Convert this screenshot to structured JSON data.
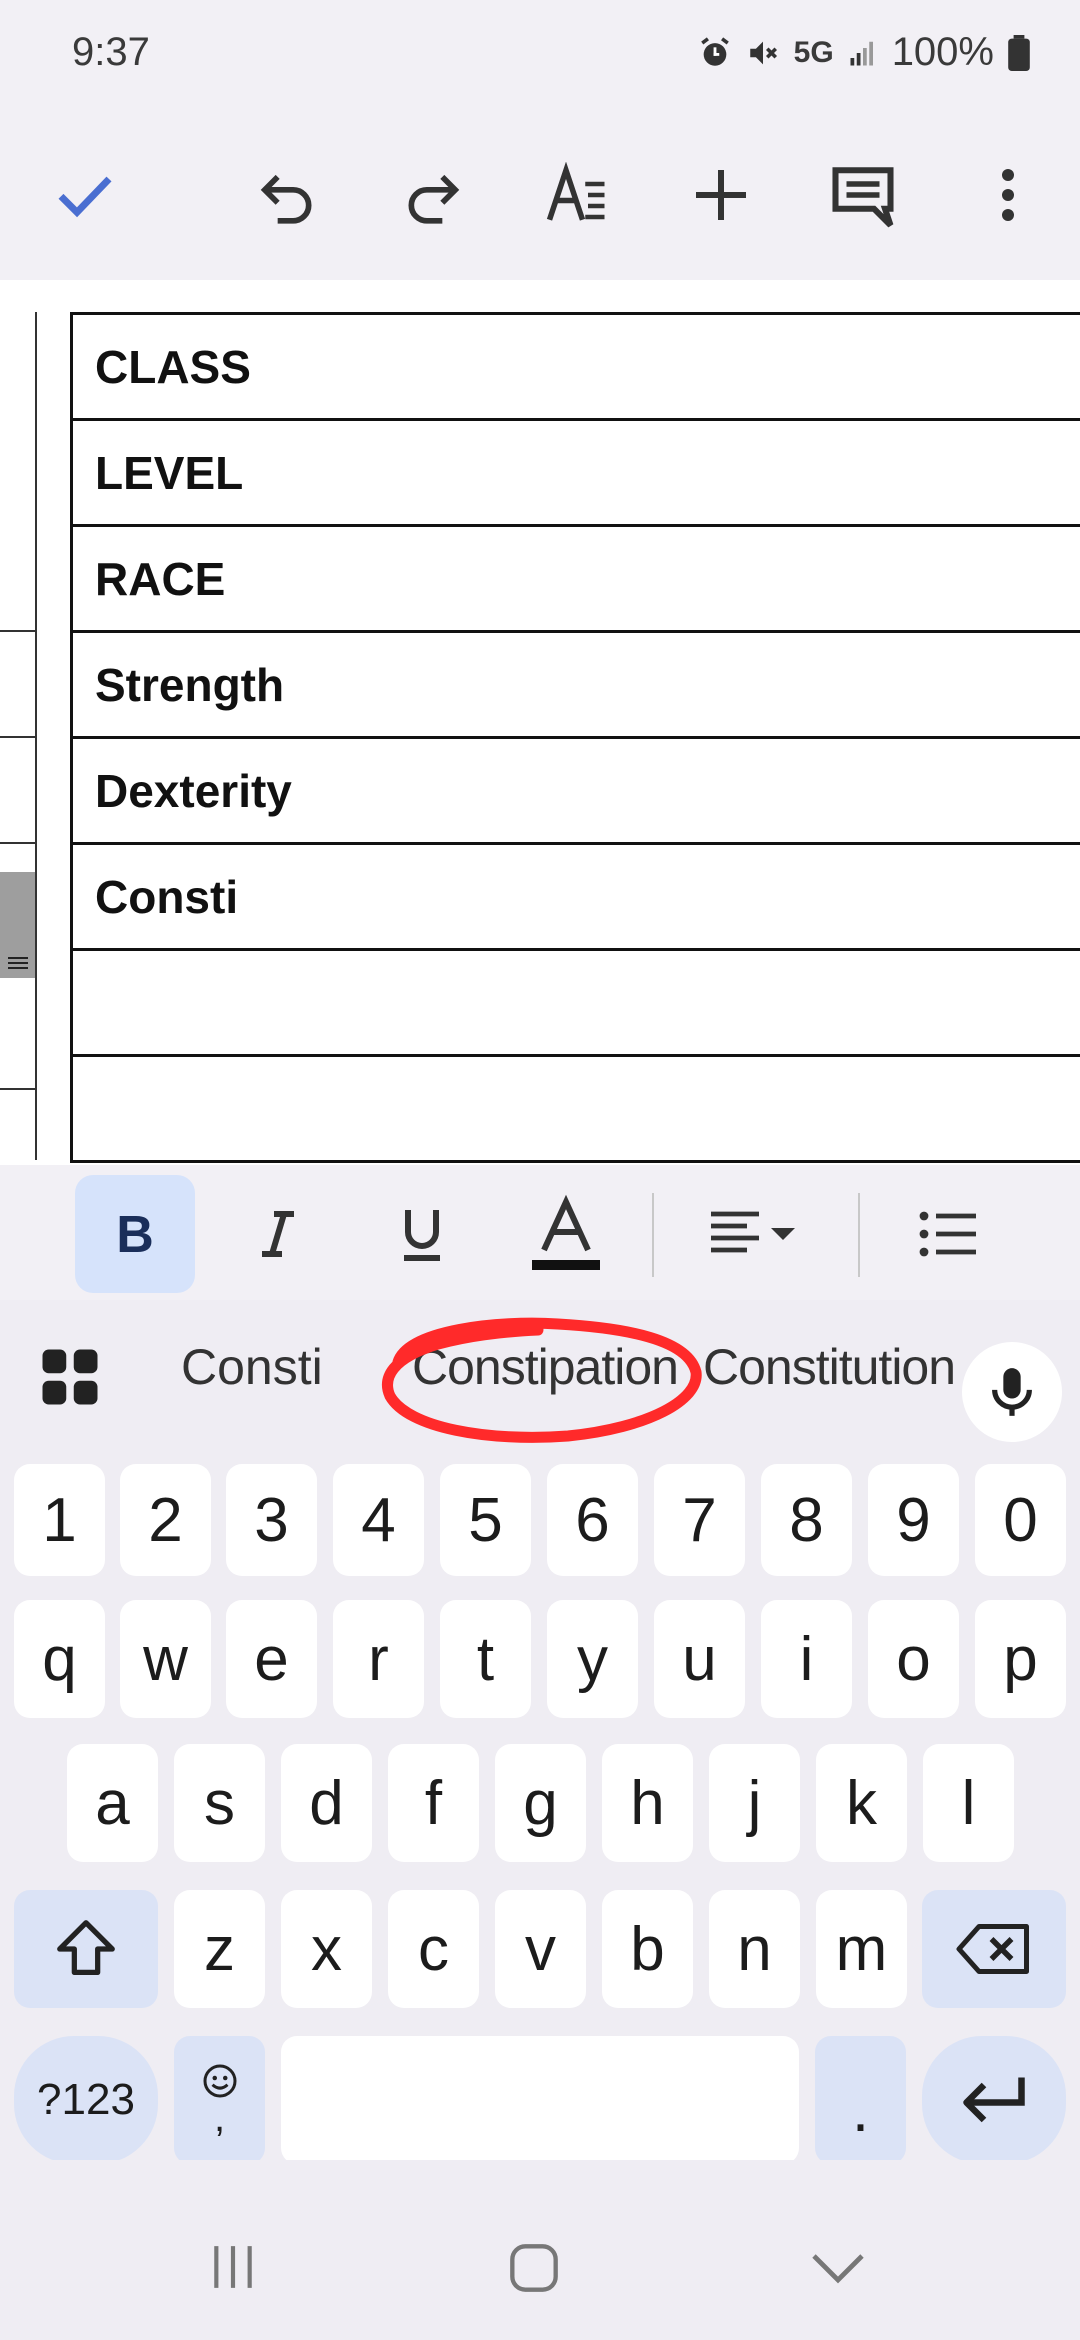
{
  "status_bar": {
    "time": "9:37",
    "network": "5G",
    "battery": "100%"
  },
  "document": {
    "rows": [
      "CLASS",
      "LEVEL",
      "RACE",
      "Strength",
      "Dexterity",
      "Consti",
      "",
      ""
    ]
  },
  "keyboard": {
    "suggestions": [
      "Consti",
      "Constipation",
      "Constitution"
    ],
    "number_row": [
      "1",
      "2",
      "3",
      "4",
      "5",
      "6",
      "7",
      "8",
      "9",
      "0"
    ],
    "row1": [
      "q",
      "w",
      "e",
      "r",
      "t",
      "y",
      "u",
      "i",
      "o",
      "p"
    ],
    "row2": [
      "a",
      "s",
      "d",
      "f",
      "g",
      "h",
      "j",
      "k",
      "l"
    ],
    "row3": [
      "z",
      "x",
      "c",
      "v",
      "b",
      "n",
      "m"
    ],
    "symbols_label": "?123",
    "period_label": ".",
    "comma_label": ","
  },
  "colors": {
    "accent": "#4a6ed1",
    "annotation_circle": "#ff2a2a",
    "bold_active": "#d6e3fb"
  }
}
